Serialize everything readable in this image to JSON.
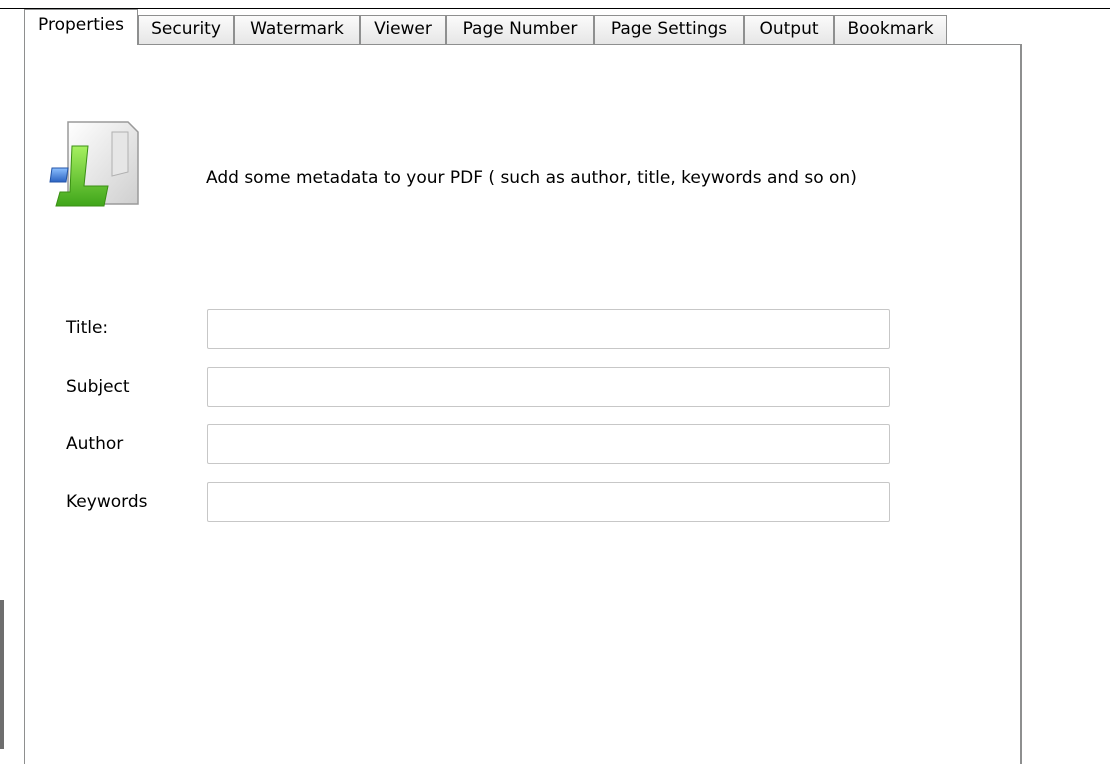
{
  "tabs": [
    {
      "label": "Properties",
      "active": true
    },
    {
      "label": "Security",
      "active": false
    },
    {
      "label": "Watermark",
      "active": false
    },
    {
      "label": "Viewer",
      "active": false
    },
    {
      "label": "Page Number",
      "active": false
    },
    {
      "label": "Page Settings",
      "active": false
    },
    {
      "label": "Output",
      "active": false
    },
    {
      "label": "Bookmark",
      "active": false
    }
  ],
  "properties": {
    "icon": "document-metadata-icon",
    "description": "Add some metadata to your PDF ( such as author, title, keywords and so on)",
    "fields": {
      "title": {
        "label": "Title:",
        "value": "",
        "placeholder": ""
      },
      "subject": {
        "label": "Subject",
        "value": "",
        "placeholder": ""
      },
      "author": {
        "label": "Author",
        "value": "",
        "placeholder": ""
      },
      "keywords": {
        "label": "Keywords",
        "value": "",
        "placeholder": ""
      }
    }
  },
  "colors": {
    "border": "#8e8f8f",
    "input_border": "#c7c7c7",
    "icon_green": "#6fcf2a",
    "icon_blue": "#3f7fd8"
  }
}
